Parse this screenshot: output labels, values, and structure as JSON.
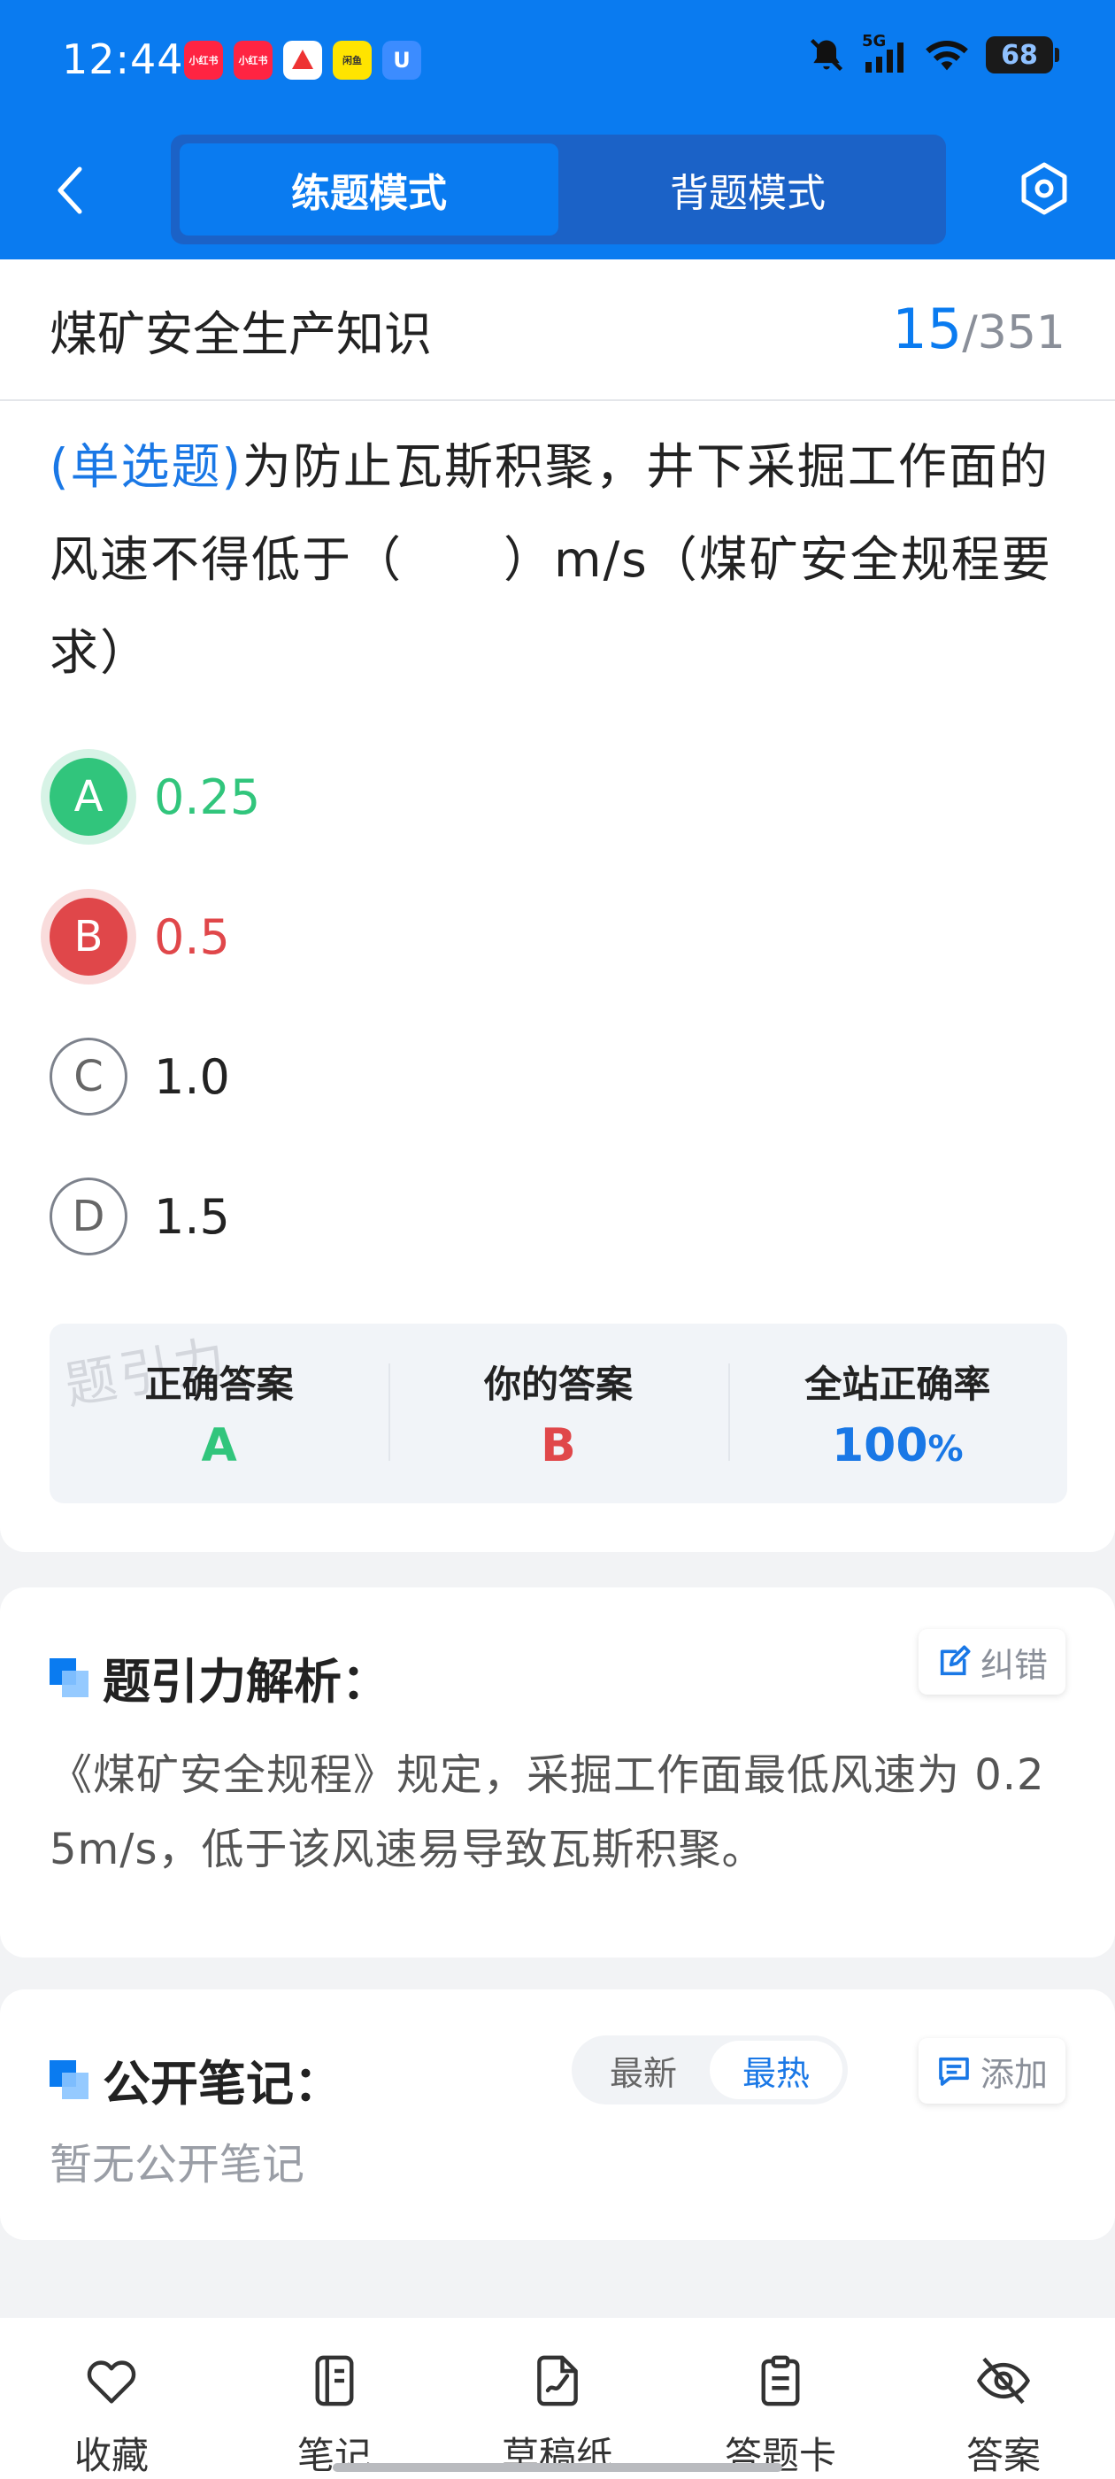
{
  "status_bar": {
    "time": "12:44",
    "battery": "68",
    "network": "5G",
    "app_badges": [
      {
        "label": "小红书",
        "color": "#ff2442"
      },
      {
        "label": "小红书",
        "color": "#ff2442"
      },
      {
        "label": "",
        "color": "#ffffff"
      },
      {
        "label": "闲鱼",
        "color": "#ffe400"
      },
      {
        "label": "U",
        "color": "#3c8cff"
      }
    ]
  },
  "nav": {
    "back_icon": "chevron-left-icon",
    "tabs": [
      {
        "label": "练题模式",
        "active": true
      },
      {
        "label": "背题模式",
        "active": false
      }
    ],
    "settings_icon": "settings-hex-icon"
  },
  "subject": {
    "title": "煤矿安全生产知识",
    "current": "15",
    "separator": "/",
    "total": "351"
  },
  "question": {
    "type": "(单选题)",
    "text": "为防止瓦斯积聚，井下采掘工作面的风速不得低于（　　）m/s（煤矿安全规程要求）",
    "options": [
      {
        "letter": "A",
        "text": "0.25",
        "state": "correct"
      },
      {
        "letter": "B",
        "text": "0.5",
        "state": "wrong"
      },
      {
        "letter": "C",
        "text": "1.0",
        "state": "normal"
      },
      {
        "letter": "D",
        "text": "1.5",
        "state": "normal"
      }
    ]
  },
  "answer_panel": {
    "watermark": "题引力",
    "correct_label": "正确答案",
    "correct_value": "A",
    "yours_label": "你的答案",
    "yours_value": "B",
    "rate_label": "全站正确率",
    "rate_value": "100",
    "rate_unit": "%"
  },
  "analysis": {
    "title": "题引力解析：",
    "report_label": "纠错",
    "text": "《煤矿安全规程》规定，采掘工作面最低风速为 0.25m/s，低于该风速易导致瓦斯积聚。"
  },
  "notes": {
    "title": "公开笔记：",
    "sort_options": [
      {
        "label": "最新",
        "active": false
      },
      {
        "label": "最热",
        "active": true
      }
    ],
    "add_label": "添加",
    "empty_text": "暂无公开笔记"
  },
  "bottom_tabs": [
    {
      "label": "收藏",
      "icon": "heart-icon"
    },
    {
      "label": "笔记",
      "icon": "notebook-icon"
    },
    {
      "label": "草稿纸",
      "icon": "draft-paper-icon"
    },
    {
      "label": "答题卡",
      "icon": "answer-sheet-icon"
    },
    {
      "label": "答案",
      "icon": "eye-off-icon"
    }
  ],
  "colors": {
    "primary": "#0a7bf0",
    "correct": "#31c57c",
    "wrong": "#e0474a"
  }
}
